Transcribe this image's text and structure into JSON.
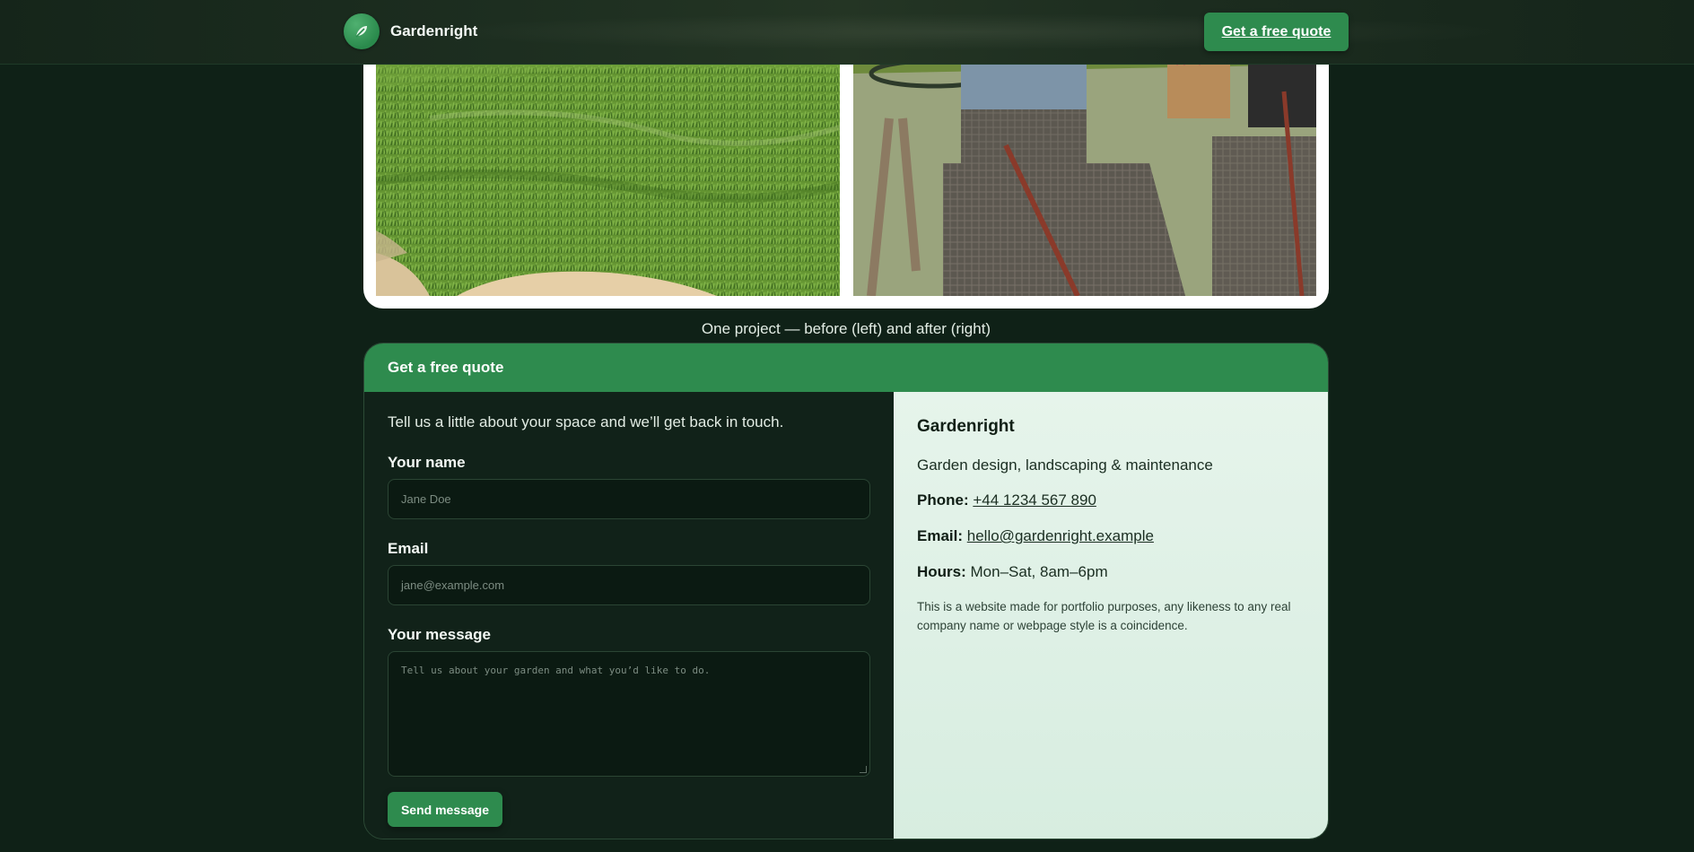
{
  "header": {
    "brand": "Gardenright",
    "cta": "Get a free quote"
  },
  "icons": {
    "logo": "leaf-icon"
  },
  "colors": {
    "accent": "#2e8b4e",
    "background": "#0f2117",
    "info_panel": "#e6f4eb"
  },
  "gallery": {
    "caption": "One project — before (left) and after (right)"
  },
  "quote": {
    "title": "Get a free quote",
    "intro": "Tell us a little about your space and we’ll get back in touch.",
    "name_label": "Your name",
    "name_placeholder": "Jane Doe",
    "email_label": "Email",
    "email_placeholder": "jane@example.com",
    "message_label": "Your message",
    "message_placeholder": "Tell us about your garden and what you’d like to do.",
    "send": "Send message"
  },
  "info": {
    "company": "Gardenright",
    "tagline": "Garden design, landscaping & maintenance",
    "phone_label": "Phone:",
    "phone": "+44 1234 567 890",
    "email_label": "Email:",
    "email": "hello@gardenright.example",
    "hours_label": "Hours:",
    "hours": "Mon–Sat, 8am–6pm",
    "disclaimer": "This is a website made for portfolio purposes, any likeness to any real company name or webpage style is a coincidence."
  }
}
